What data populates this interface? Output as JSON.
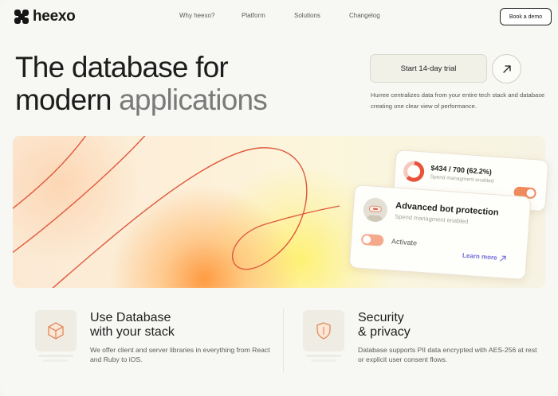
{
  "brand": {
    "name": "heexo"
  },
  "nav": {
    "links": [
      "Why heexo?",
      "Platform",
      "Solutions",
      "Changelog"
    ],
    "cta": "Book a demo"
  },
  "hero": {
    "title_line1": "The database for",
    "title_line2_main": "modern ",
    "title_line2_fade": "applications",
    "trial_button": "Start 14-day trial",
    "description": "Hurree centralizes data from your entire tech stack and database creating one clear view of performance."
  },
  "banner": {
    "spend_card": {
      "amount": "$434 / 700 (62.2%)",
      "subtitle": "Spend managment enabled",
      "progress": 0.622
    },
    "bot_card": {
      "title": "Advanced bot protection",
      "subtitle": "Spend managment enabled",
      "toggle_label": "Activate",
      "link": "Learn more"
    },
    "accent": "#e7543b"
  },
  "features": [
    {
      "icon": "cube-icon",
      "title_line1": "Use Database",
      "title_line2": "with your stack",
      "description": "We offer client and server libraries in everything from React and Ruby to iOS."
    },
    {
      "icon": "shield-icon",
      "title_line1": "Security",
      "title_line2": "& privacy",
      "description": "Database supports PII data encrypted with AES-256 at rest or explicit user consent flows."
    }
  ]
}
